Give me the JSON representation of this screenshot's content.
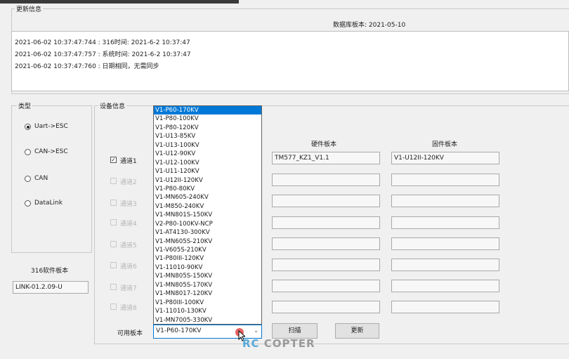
{
  "window": {
    "update_group_title": "更新信息",
    "db_version": "数据库板本: 2021-05-10"
  },
  "log": [
    "2021-06-02 10:37:47:744 : 316时间: 2021-6-2 10:37:47",
    "2021-06-02 10:37:47:757 : 系统时间: 2021-6-2 10:37:47",
    "2021-06-02 10:37:47:760 : 日期相同，无需同步"
  ],
  "type_group": {
    "title": "类型",
    "options": [
      {
        "label": "Uart->ESC",
        "selected": true
      },
      {
        "label": "CAN->ESC",
        "selected": false
      },
      {
        "label": "CAN",
        "selected": false
      },
      {
        "label": "DataLink",
        "selected": false
      }
    ]
  },
  "software": {
    "label": "316软件板本",
    "value": "LINK-01.2.09-U"
  },
  "device_group": {
    "title": "设备信息",
    "hardware_header": "硬件板本",
    "firmware_header": "固件板本",
    "channels": [
      {
        "label": "通道1",
        "checked": true,
        "enabled": true,
        "hardware": "TM577_KZ1_V1.1",
        "firmware": "V1-U12II-120KV"
      },
      {
        "label": "通道2",
        "checked": false,
        "enabled": false,
        "hardware": "",
        "firmware": ""
      },
      {
        "label": "通道3",
        "checked": false,
        "enabled": false,
        "hardware": "",
        "firmware": ""
      },
      {
        "label": "通道4",
        "checked": false,
        "enabled": false,
        "hardware": "",
        "firmware": ""
      },
      {
        "label": "通道5",
        "checked": false,
        "enabled": false,
        "hardware": "",
        "firmware": ""
      },
      {
        "label": "通道6",
        "checked": false,
        "enabled": false,
        "hardware": "",
        "firmware": ""
      },
      {
        "label": "通道7",
        "checked": false,
        "enabled": false,
        "hardware": "",
        "firmware": ""
      },
      {
        "label": "通道8",
        "checked": false,
        "enabled": false,
        "hardware": "",
        "firmware": ""
      }
    ],
    "available_label": "可用板本",
    "selected_version": "V1-P60-170KV",
    "scan_button": "扫描",
    "update_button": "更新"
  },
  "version_options": [
    "V1-P60-170KV",
    "V1-P80-100KV",
    "V1-P80-120KV",
    "V1-U13-85KV",
    "V1-U13-100KV",
    "V1-U12-90KV",
    "V1-U12-100KV",
    "V1-U11-120KV",
    "V1-U12II-120KV",
    "V1-P80-80KV",
    "V1-MN605-240KV",
    "V1-M850-240KV",
    "V1-MN801S-150KV",
    "V2-P80-100KV-NCP",
    "V1-AT4130-300KV",
    "V1-MN605S-210KV",
    "V1-V605S-210KV",
    "V1-P80III-120KV",
    "V1-11010-90KV",
    "V1-MN805S-150KV",
    "V1-MN805S-170KV",
    "V1-MN8017-120KV",
    "V1-P80III-100KV",
    "V1-11010-130KV",
    "V1-MN7005-330KV"
  ],
  "watermark": "RC COPTER",
  "colors": {
    "selection": "#0078d7",
    "background": "#f0f0f0"
  }
}
